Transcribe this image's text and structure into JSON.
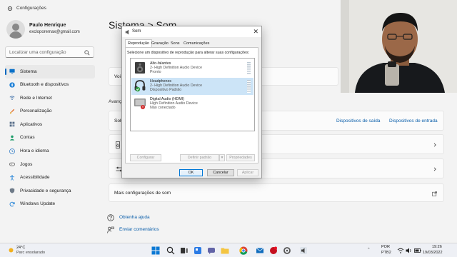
{
  "window": {
    "title": "Configurações"
  },
  "user": {
    "name": "Paulo Henrique",
    "email": "excloporemax@gmail.com"
  },
  "search": {
    "placeholder": "Localizar uma configuração"
  },
  "sidebar": {
    "items": [
      {
        "label": "Sistema",
        "icon": "monitor-icon",
        "active": true
      },
      {
        "label": "Bluetooth e dispositivos",
        "icon": "bluetooth-icon"
      },
      {
        "label": "Rede e Internet",
        "icon": "wifi-icon"
      },
      {
        "label": "Personalização",
        "icon": "paintbrush-icon"
      },
      {
        "label": "Aplicativos",
        "icon": "apps-icon"
      },
      {
        "label": "Contas",
        "icon": "person-icon"
      },
      {
        "label": "Hora e idioma",
        "icon": "globe-clock-icon"
      },
      {
        "label": "Jogos",
        "icon": "gamepad-icon"
      },
      {
        "label": "Acessibilidade",
        "icon": "accessibility-icon"
      },
      {
        "label": "Privacidade e segurança",
        "icon": "shield-icon"
      },
      {
        "label": "Windows Update",
        "icon": "update-icon"
      }
    ]
  },
  "main": {
    "breadcrumb": "Sistema  >  Som",
    "partial_label_1": "Voi",
    "section_label": "Avanç",
    "partial_label_2": "Solu",
    "link_output_devices": "Dispositivos de saída",
    "link_input_devices": "Dispositivos de entrada",
    "more_sound_settings": "Mais configurações de som",
    "get_help": "Obtenha ajuda",
    "send_feedback": "Enviar comentários"
  },
  "dialog": {
    "title": "Som",
    "tabs": [
      "Reprodução",
      "Gravação",
      "Sons",
      "Comunicações"
    ],
    "instruction": "Selecione um dispositivo de reprodução para alterar suas configurações:",
    "devices": [
      {
        "name": "Alto-falantes",
        "description": "2- High Definition Audio Device",
        "status": "Pronto",
        "icon": "speaker-icon",
        "selected": false
      },
      {
        "name": "Headphones",
        "description": "2- High Definition Audio Device",
        "status": "Dispositivo Padrão",
        "icon": "headphones-icon",
        "selected": true
      },
      {
        "name": "Digital Audio (HDMI)",
        "description": "High Definition Audio Device",
        "status": "Não conectado",
        "icon": "hdmi-device-icon",
        "selected": false
      }
    ],
    "buttons": {
      "configure": "Configurar",
      "set_default": "Definir padrão",
      "properties": "Propriedades",
      "ok": "OK",
      "cancel": "Cancelar",
      "apply": "Aplicar"
    }
  },
  "taskbar": {
    "temperature": "24°C",
    "weather": "Parc ensolarado",
    "language": "POR",
    "keyboard": "PTB2",
    "time": "19:26",
    "date": "19/03/2022"
  },
  "colors": {
    "accent": "#0067c0",
    "link": "#0a5eaa",
    "selection": "#cce4f7"
  }
}
